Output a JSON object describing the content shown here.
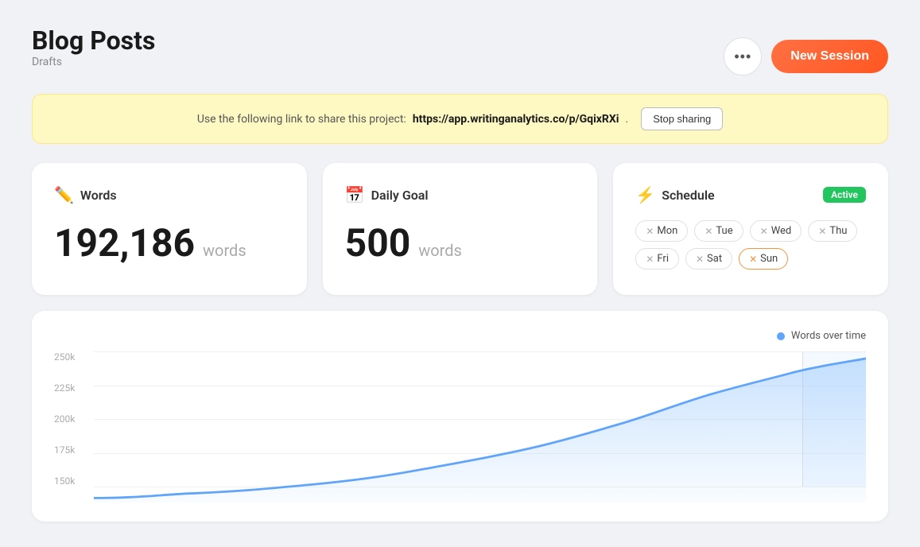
{
  "header": {
    "title": "Blog Posts",
    "subtitle": "Drafts",
    "more_button_label": "•••",
    "new_session_label": "New Session"
  },
  "banner": {
    "text_prefix": "Use the following link to share this project:",
    "link": "https://app.writinganalytics.co/p/GqixRXi",
    "text_suffix": ".",
    "stop_sharing_label": "Stop sharing"
  },
  "cards": {
    "words": {
      "icon": "✏️",
      "label": "Words",
      "value": "192,186",
      "unit": "words"
    },
    "daily_goal": {
      "icon": "📅",
      "label": "Daily Goal",
      "value": "500",
      "unit": "words"
    },
    "schedule": {
      "icon": "⚡",
      "label": "Schedule",
      "badge": "Active",
      "days": [
        {
          "name": "Mon",
          "active": true,
          "sunday": false
        },
        {
          "name": "Tue",
          "active": true,
          "sunday": false
        },
        {
          "name": "Wed",
          "active": true,
          "sunday": false
        },
        {
          "name": "Thu",
          "active": true,
          "sunday": false
        },
        {
          "name": "Fri",
          "active": true,
          "sunday": false
        },
        {
          "name": "Sat",
          "active": true,
          "sunday": false
        },
        {
          "name": "Sun",
          "active": true,
          "sunday": true
        }
      ]
    }
  },
  "chart": {
    "legend_label": "Words over time",
    "y_labels": [
      "250k",
      "225k",
      "200k",
      "175k",
      "150k"
    ],
    "legend_dot_color": "#60a5fa"
  }
}
